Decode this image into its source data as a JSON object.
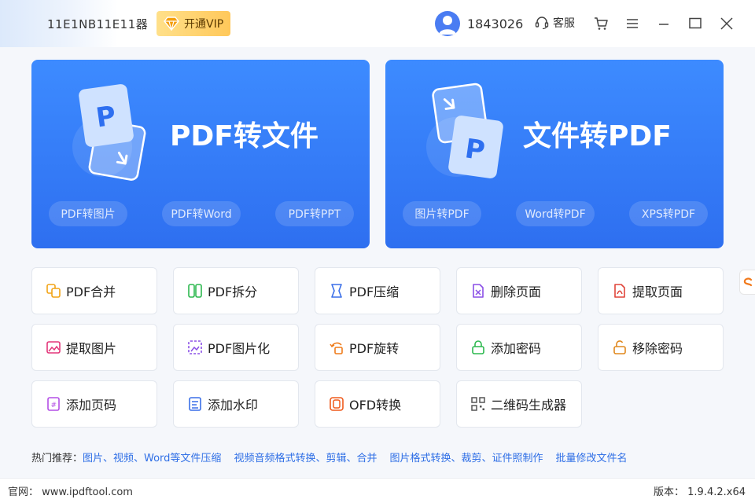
{
  "titlebar": {
    "app_title": "11E1NB11E11器",
    "vip_label": "开通VIP",
    "user_id": "1843026",
    "service_label": "客服"
  },
  "hero": {
    "left": {
      "title": "PDF转文件",
      "pills": [
        "PDF转图片",
        "PDF转Word",
        "PDF转PPT"
      ]
    },
    "right": {
      "title": "文件转PDF",
      "pills": [
        "图片转PDF",
        "Word转PDF",
        "XPS转PDF"
      ]
    }
  },
  "tools": [
    {
      "label": "PDF合并",
      "icon": "merge-icon",
      "color": "#f2a417"
    },
    {
      "label": "PDF拆分",
      "icon": "split-icon",
      "color": "#2db84f"
    },
    {
      "label": "PDF压缩",
      "icon": "compress-icon",
      "color": "#3a6fe8"
    },
    {
      "label": "删除页面",
      "icon": "delete-page-icon",
      "color": "#8a4fe6"
    },
    {
      "label": "提取页面",
      "icon": "extract-page-icon",
      "color": "#e0453a"
    },
    {
      "label": "提取图片",
      "icon": "extract-image-icon",
      "color": "#e3367a"
    },
    {
      "label": "PDF图片化",
      "icon": "to-image-icon",
      "color": "#8a4fe6"
    },
    {
      "label": "PDF旋转",
      "icon": "rotate-icon",
      "color": "#ef7c1c"
    },
    {
      "label": "添加密码",
      "icon": "lock-icon",
      "color": "#2db84f"
    },
    {
      "label": "移除密码",
      "icon": "unlock-icon",
      "color": "#e0891f"
    },
    {
      "label": "添加页码",
      "icon": "page-number-icon",
      "color": "#b44fe6"
    },
    {
      "label": "添加水印",
      "icon": "watermark-icon",
      "color": "#3a6fe8"
    },
    {
      "label": "OFD转换",
      "icon": "ofd-icon",
      "color": "#ef5a1c"
    },
    {
      "label": "二维码生成器",
      "icon": "qrcode-icon",
      "color": "#555555"
    }
  ],
  "hot": {
    "label": "热门推荐：",
    "links": [
      "图片、视频、Word等文件压缩",
      "视频音频格式转换、剪辑、合并",
      "图片格式转换、裁剪、证件照制作",
      "批量修改文件名"
    ]
  },
  "footer": {
    "site_label": "官网：",
    "site_url": "www.ipdftool.com",
    "version_label": "版本：",
    "version": "1.9.4.2.x64"
  }
}
